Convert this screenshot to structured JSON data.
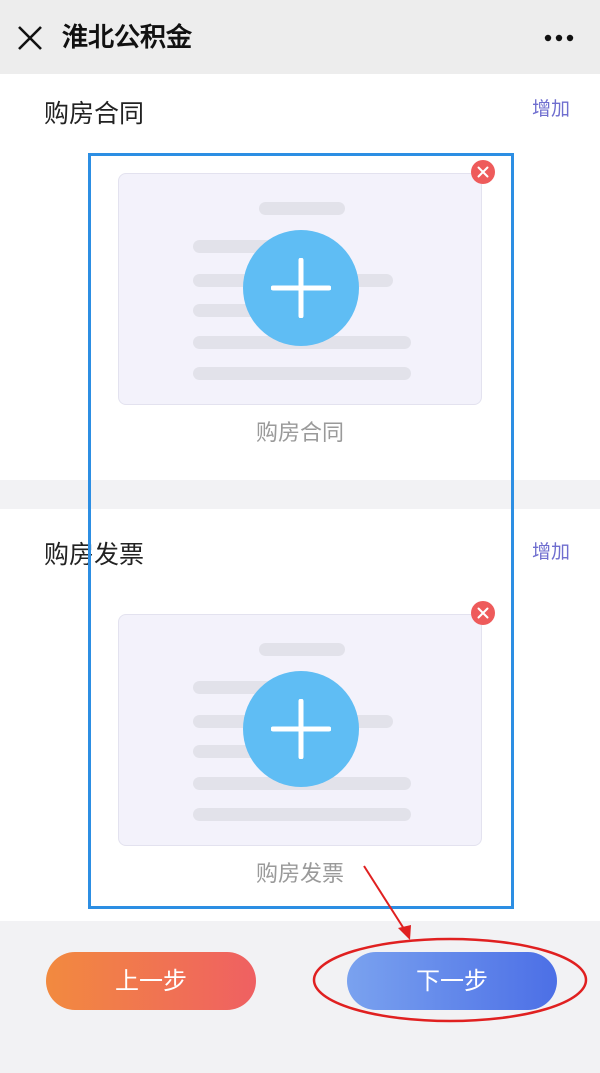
{
  "header": {
    "title": "淮北公积金",
    "close_icon": "close-icon",
    "more_icon": "more-dots-icon"
  },
  "sections": [
    {
      "title": "购房合同",
      "add_label": "增加",
      "card_caption": "购房合同"
    },
    {
      "title": "购房发票",
      "add_label": "增加",
      "card_caption": "购房发票"
    }
  ],
  "footer": {
    "prev_label": "上一步",
    "next_label": "下一步"
  },
  "colors": {
    "accent_blue": "#5fbdf4",
    "link_purple": "#6f6ecf",
    "remove_red": "#ee5b5b",
    "annotation_red": "#e02020",
    "annotation_blue": "#2c8ee3"
  }
}
